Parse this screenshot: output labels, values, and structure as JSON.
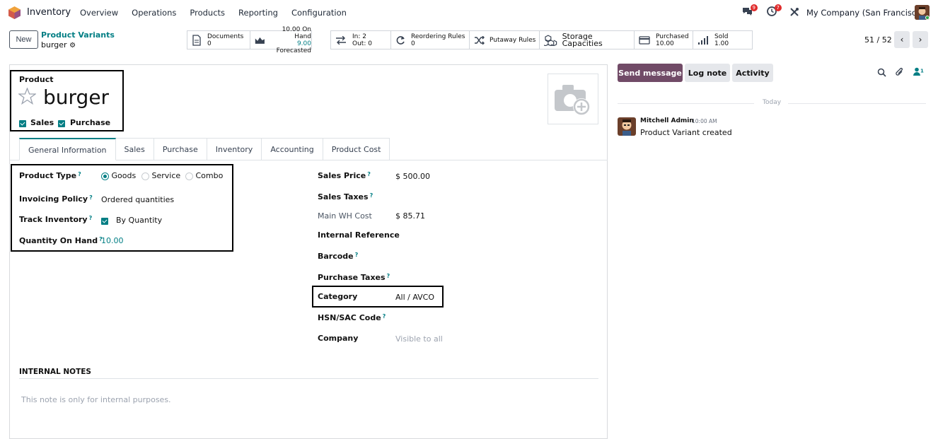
{
  "app": {
    "name": "Inventory"
  },
  "menu": [
    "Overview",
    "Operations",
    "Products",
    "Reporting",
    "Configuration"
  ],
  "systray": {
    "messages_count": "9",
    "activity_count": "7",
    "company": "My Company (San Francisco)"
  },
  "control": {
    "new_label": "New",
    "breadcrumb_parent": "Product Variants",
    "breadcrumb_current": "burger",
    "pager": "51 / 52"
  },
  "smart_buttons": {
    "documents": {
      "label": "Documents",
      "value": "0"
    },
    "on_hand": {
      "line1": "10.00 On Hand",
      "line2_value": "9.00",
      "line2_label": "Forecasted"
    },
    "in_out": {
      "in": "In: 2",
      "out": "Out: 0"
    },
    "reordering": {
      "label": "Reordering Rules",
      "value": "0"
    },
    "putaway": {
      "label": "Putaway Rules"
    },
    "storage": {
      "label": "Storage Capacities"
    },
    "purchased": {
      "label": "Purchased",
      "value": "10.00"
    },
    "sold": {
      "label": "Sold",
      "value": "1.00"
    }
  },
  "product": {
    "section_label": "Product",
    "name": "burger",
    "sales_label": "Sales",
    "purchase_label": "Purchase"
  },
  "tabs": [
    "General Information",
    "Sales",
    "Purchase",
    "Inventory",
    "Accounting",
    "Product Cost"
  ],
  "left_fields": {
    "product_type_label": "Product Type",
    "type_options": [
      "Goods",
      "Service",
      "Combo"
    ],
    "invoicing_policy_label": "Invoicing Policy",
    "invoicing_policy_value": "Ordered quantities",
    "track_inventory_label": "Track Inventory",
    "track_inventory_value": "By Quantity",
    "qty_on_hand_label": "Quantity On Hand",
    "qty_on_hand_value": "10.00"
  },
  "right_fields": {
    "sales_price_label": "Sales Price",
    "sales_price_value": "$ 500.00",
    "sales_taxes_label": "Sales Taxes",
    "main_wh_cost_label": "Main WH Cost",
    "main_wh_cost_value": "$ 85.71",
    "internal_ref_label": "Internal Reference",
    "barcode_label": "Barcode",
    "purchase_taxes_label": "Purchase Taxes",
    "category_label": "Category",
    "category_value": "All / AVCO",
    "hsn_label": "HSN/SAC Code",
    "company_label": "Company",
    "company_placeholder": "Visible to all"
  },
  "notes": {
    "title": "INTERNAL NOTES",
    "placeholder": "This note is only for internal purposes."
  },
  "chatter": {
    "send_message": "Send message",
    "log_note": "Log note",
    "activity": "Activity",
    "followers_count": "1",
    "date_separator": "Today",
    "author": "Mitchell Admin",
    "time": "10:00 AM",
    "message": "Product Variant created"
  },
  "colors": {
    "accent": "#017e84",
    "primary_btn": "#714b67",
    "badge": "#e02b2b"
  }
}
